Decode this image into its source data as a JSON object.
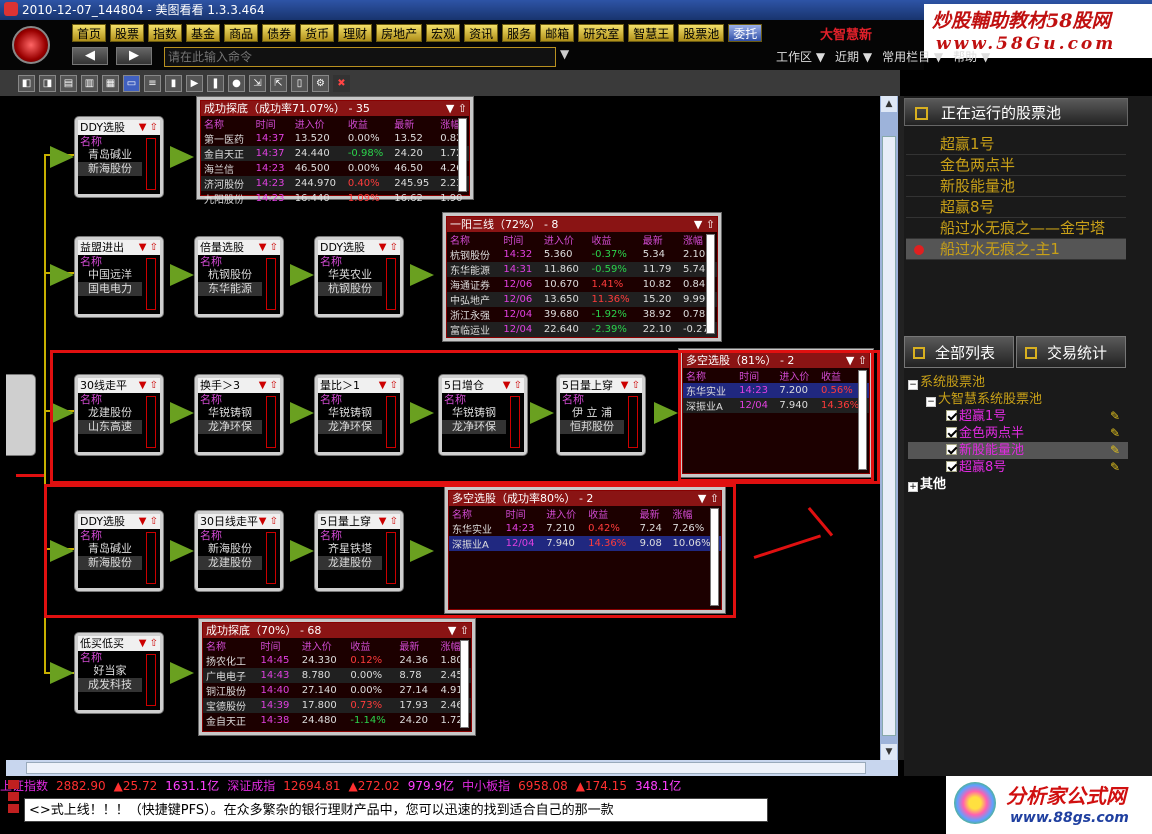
{
  "app": {
    "title": "2010-12-07_144804 - 美图看看 1.3.3.464"
  },
  "watermark_top": {
    "line1": "炒股輔助教材58股网",
    "line2": "www.58Gu.com"
  },
  "menu": [
    "首页",
    "股票",
    "指数",
    "基金",
    "商品",
    "债券",
    "货币",
    "理财",
    "房地产",
    "宏观",
    "资讯",
    "服务",
    "邮箱",
    "研究室",
    "智慧王",
    "股票池",
    "委托"
  ],
  "brand": "大智慧新",
  "command": {
    "placeholder": "请在此输入命令",
    "back": "◀",
    "forward": "▶"
  },
  "workspace_menu": [
    "工作区 ▼",
    "近期 ▼",
    "常用栏目 ▼",
    "帮助 ▼"
  ],
  "nodes": [
    {
      "title": "DDY选股",
      "label": "名称",
      "rows": [
        "青岛碱业",
        "新海股份"
      ]
    },
    {
      "title": "益盟进出",
      "label": "名称",
      "rows": [
        "中国远洋",
        "国电电力"
      ]
    },
    {
      "title": "倍量选股",
      "label": "名称",
      "rows": [
        "杭钢股份",
        "东华能源"
      ]
    },
    {
      "title": "DDY选股",
      "label": "名称",
      "rows": [
        "华英农业",
        "杭钢股份"
      ]
    },
    {
      "title": "30线走平",
      "label": "名称",
      "rows": [
        "龙建股份",
        "山东高速"
      ]
    },
    {
      "title": "换手＞3",
      "label": "名称",
      "rows": [
        "华锐铸钢",
        "龙净环保"
      ]
    },
    {
      "title": "量比＞1",
      "label": "名称",
      "rows": [
        "华锐铸钢",
        "龙净环保"
      ]
    },
    {
      "title": "5日增仓",
      "label": "名称",
      "rows": [
        "华锐铸钢",
        "龙净环保"
      ]
    },
    {
      "title": "5日量上穿",
      "label": "名称",
      "rows": [
        "伊 立 浦",
        "恒邦股份"
      ]
    },
    {
      "title": "DDY选股",
      "label": "名称",
      "rows": [
        "青岛碱业",
        "新海股份"
      ]
    },
    {
      "title": "30日线走平",
      "label": "名称",
      "rows": [
        "新海股份",
        "龙建股份"
      ]
    },
    {
      "title": "5日量上穿",
      "label": "名称",
      "rows": [
        "齐星铁塔",
        "龙建股份"
      ]
    },
    {
      "title": "低买低买",
      "label": "名称",
      "rows": [
        "好当家",
        "成发科技"
      ]
    }
  ],
  "pools": [
    {
      "title": "成功探底（成功率71.07%） - 35",
      "cols": [
        "名称",
        "时间",
        "进入价",
        "收益",
        "最新",
        "涨幅"
      ],
      "rows": [
        [
          "第一医药",
          "14:37",
          "13.520",
          "0.00%",
          "13.52",
          "0.82"
        ],
        [
          "金自天正",
          "14:37",
          "24.440",
          "-0.98%",
          "24.20",
          "1.72"
        ],
        [
          "海兰信",
          "14:23",
          "46.500",
          "0.00%",
          "46.50",
          "4.26"
        ],
        [
          "济河股份",
          "14:23",
          "244.970",
          "0.40%",
          "245.95",
          "2.23"
        ],
        [
          "九阳股份",
          "14:23",
          "16.440",
          "1.09%",
          "16.62",
          "1.90"
        ]
      ]
    },
    {
      "title": "一阳三线（72%） - 8",
      "cols": [
        "名称",
        "时间",
        "进入价",
        "收益",
        "最新",
        "涨幅"
      ],
      "rows": [
        [
          "杭钢股份",
          "14:32",
          "5.360",
          "-0.37%",
          "5.34",
          "2.10"
        ],
        [
          "东华能源",
          "14:31",
          "11.860",
          "-0.59%",
          "11.79",
          "5.74"
        ],
        [
          "海通证券",
          "12/06",
          "10.670",
          "1.41%",
          "10.82",
          "0.84"
        ],
        [
          "中弘地产",
          "12/06",
          "13.650",
          "11.36%",
          "15.20",
          "9.99"
        ],
        [
          "浙江永强",
          "12/04",
          "39.680",
          "-1.92%",
          "38.92",
          "0.78"
        ],
        [
          "富临运业",
          "12/04",
          "22.640",
          "-2.39%",
          "22.10",
          "-0.27"
        ]
      ]
    },
    {
      "title": "多空选股（81%） - 2",
      "cols": [
        "名称",
        "时间",
        "进入价",
        "收益"
      ],
      "rows": [
        [
          "东华实业",
          "14:23",
          "7.200",
          "0.56%"
        ],
        [
          "深振业A",
          "12/04",
          "7.940",
          "14.36%"
        ]
      ]
    },
    {
      "title": "多空选股（成功率80%） - 2",
      "cols": [
        "名称",
        "时间",
        "进入价",
        "收益",
        "最新",
        "涨幅"
      ],
      "rows": [
        [
          "东华实业",
          "14:23",
          "7.210",
          "0.42%",
          "7.24",
          "7.26%"
        ],
        [
          "深振业A",
          "12/04",
          "7.940",
          "14.36%",
          "9.08",
          "10.06%"
        ]
      ]
    },
    {
      "title": "成功探底（70%） - 68",
      "cols": [
        "名称",
        "时间",
        "进入价",
        "收益",
        "最新",
        "涨幅"
      ],
      "rows": [
        [
          "扬农化工",
          "14:45",
          "24.330",
          "0.12%",
          "24.36",
          "1.80"
        ],
        [
          "广电电子",
          "14:43",
          "8.780",
          "0.00%",
          "8.78",
          "2.45"
        ],
        [
          "铜江股份",
          "14:40",
          "27.140",
          "0.00%",
          "27.14",
          "4.91"
        ],
        [
          "宝德股份",
          "14:39",
          "17.800",
          "0.73%",
          "17.93",
          "2.46"
        ],
        [
          "金自天正",
          "14:38",
          "24.480",
          "-1.14%",
          "24.20",
          "1.72"
        ]
      ]
    }
  ],
  "right_panel": {
    "run_title": "正在运行的股票池",
    "running": [
      "超赢1号",
      "金色两点半",
      "新股能量池",
      "超赢8号",
      "船过水无痕之——金宇塔",
      "船过水无痕之-主1"
    ],
    "tabs": [
      "全部列表",
      "交易统计"
    ],
    "tree": {
      "root": "系统股票池",
      "group": "大智慧系统股票池",
      "items": [
        "超赢1号",
        "金色两点半",
        "新股能量池",
        "超赢8号"
      ],
      "other": "其他"
    }
  },
  "ticker": [
    {
      "name": "上证指数",
      "value": "2882.90",
      "change": "▲25.72",
      "amount": "1631.1亿"
    },
    {
      "name": "深证成指",
      "value": "12694.81",
      "change": "▲272.02",
      "amount": "979.9亿"
    },
    {
      "name": "中小板指",
      "value": "6958.08",
      "change": "▲174.15",
      "amount": "348.1亿"
    }
  ],
  "marquee": "<>式上线！！！（快捷键PFS）。在众多繁杂的银行理财产品中，您可以迅速的找到适合自己的那一款",
  "watermark_bottom": {
    "line1": "分析家公式网",
    "line2": "www.88gs.com"
  },
  "colors": {
    "accent": "#e01010",
    "gold": "#c8a018",
    "magenta": "#e02ae0"
  }
}
